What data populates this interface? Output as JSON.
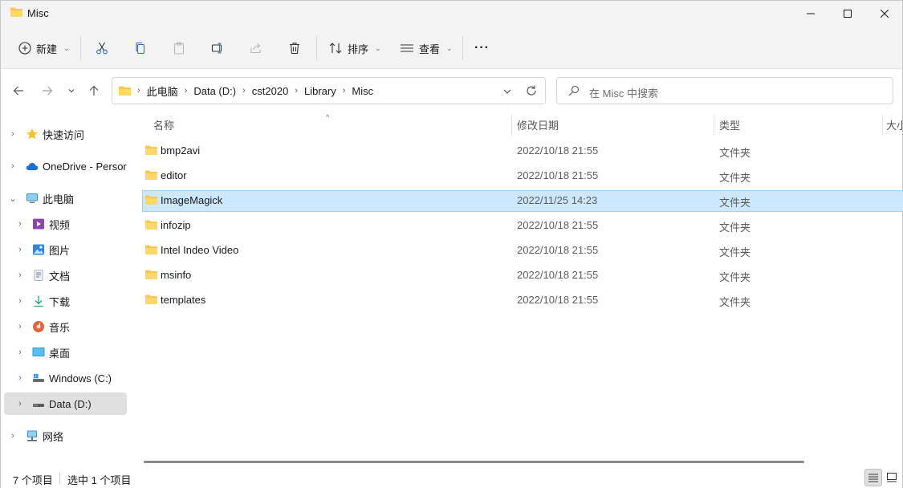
{
  "window": {
    "title": "Misc"
  },
  "commandbar": {
    "new_label": "新建",
    "sort_label": "排序",
    "view_label": "查看",
    "more_label": "···"
  },
  "address": {
    "crumbs": [
      "此电脑",
      "Data (D:)",
      "cst2020",
      "Library",
      "Misc"
    ]
  },
  "search": {
    "placeholder": "在 Misc 中搜索"
  },
  "sidebar": {
    "items": [
      {
        "label": "快速访问",
        "icon": "star-icon"
      },
      {
        "label": "OneDrive - Persor",
        "icon": "cloud-icon"
      },
      {
        "label": "此电脑",
        "icon": "computer-icon"
      },
      {
        "label": "视频",
        "icon": "video-icon"
      },
      {
        "label": "图片",
        "icon": "pictures-icon"
      },
      {
        "label": "文档",
        "icon": "documents-icon"
      },
      {
        "label": "下载",
        "icon": "download-icon"
      },
      {
        "label": "音乐",
        "icon": "music-icon"
      },
      {
        "label": "桌面",
        "icon": "desktop-icon"
      },
      {
        "label": "Windows (C:)",
        "icon": "drive-icon"
      },
      {
        "label": "Data (D:)",
        "icon": "drive-icon"
      },
      {
        "label": "网络",
        "icon": "network-icon"
      }
    ]
  },
  "columns": {
    "name": "名称",
    "date": "修改日期",
    "type": "类型",
    "size": "大小"
  },
  "files": [
    {
      "name": "bmp2avi",
      "date": "2022/10/18 21:55",
      "type": "文件夹"
    },
    {
      "name": "editor",
      "date": "2022/10/18 21:55",
      "type": "文件夹"
    },
    {
      "name": "ImageMagick",
      "date": "2022/11/25 14:23",
      "type": "文件夹"
    },
    {
      "name": "infozip",
      "date": "2022/10/18 21:55",
      "type": "文件夹"
    },
    {
      "name": "Intel Indeo Video",
      "date": "2022/10/18 21:55",
      "type": "文件夹"
    },
    {
      "name": "msinfo",
      "date": "2022/10/18 21:55",
      "type": "文件夹"
    },
    {
      "name": "templates",
      "date": "2022/10/18 21:55",
      "type": "文件夹"
    }
  ],
  "status": {
    "count": "7 个项目",
    "selected": "选中 1 个项目"
  },
  "colors": {
    "selection": "#cce8ff",
    "selection_border": "#99d1ff",
    "folder": "#f8c94a"
  }
}
